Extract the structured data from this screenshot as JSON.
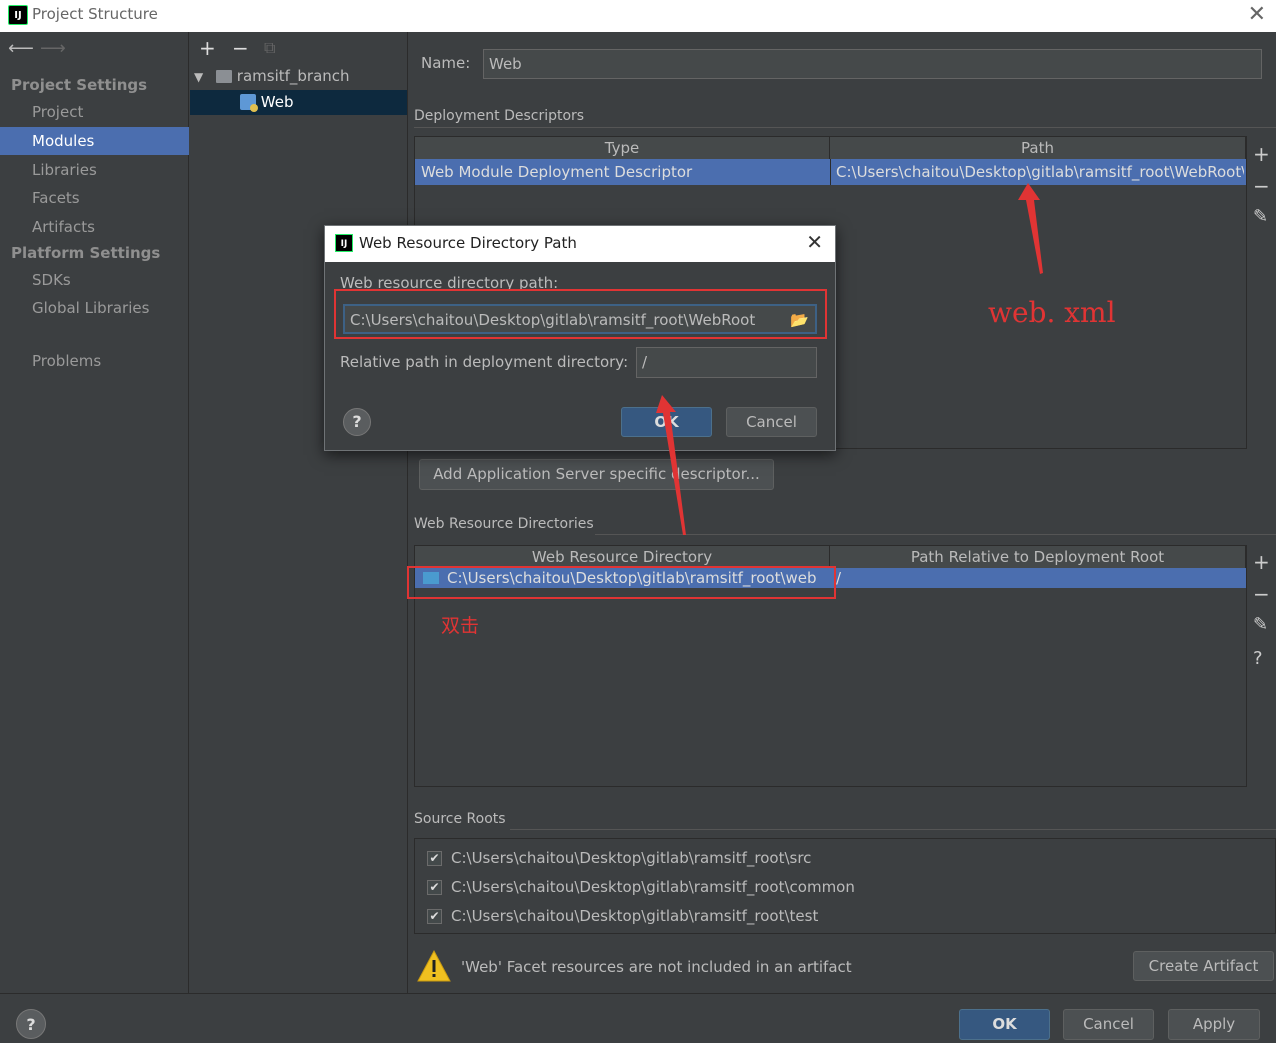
{
  "window": {
    "title": "Project Structure",
    "app_icon_text": "IJ"
  },
  "left": {
    "project_settings_label": "Project Settings",
    "project_items": [
      "Project",
      "Modules",
      "Libraries",
      "Facets",
      "Artifacts"
    ],
    "platform_settings_label": "Platform Settings",
    "platform_items": [
      "SDKs",
      "Global Libraries"
    ],
    "problems": "Problems"
  },
  "tree": {
    "root": "ramsitf_branch",
    "child": "Web"
  },
  "facet": {
    "name_label": "Name:",
    "name_value": "Web",
    "deployment_descriptors_title": "Deployment Descriptors",
    "dd_columns": [
      "Type",
      "Path"
    ],
    "dd_row": {
      "type": "Web Module Deployment Descriptor",
      "path": "C:\\Users\\chaitou\\Desktop\\gitlab\\ramsitf_root\\WebRoot\\"
    },
    "add_server_descriptor_button": "Add Application Server specific descriptor...",
    "web_resource_dirs_title": "Web Resource Directories",
    "wrd_columns": [
      "Web Resource Directory",
      "Path Relative to Deployment Root"
    ],
    "wrd_row": {
      "dir": "C:\\Users\\chaitou\\Desktop\\gitlab\\ramsitf_root\\web",
      "rel": "/"
    },
    "source_roots_title": "Source Roots",
    "source_roots": [
      "C:\\Users\\chaitou\\Desktop\\gitlab\\ramsitf_root\\src",
      "C:\\Users\\chaitou\\Desktop\\gitlab\\ramsitf_root\\common",
      "C:\\Users\\chaitou\\Desktop\\gitlab\\ramsitf_root\\test"
    ],
    "warning_text": "'Web' Facet resources are not included in an artifact",
    "create_artifact_button": "Create Artifact"
  },
  "dialog": {
    "title": "Web Resource Directory Path",
    "path_label": "Web resource directory path:",
    "path_value": "C:\\Users\\chaitou\\Desktop\\gitlab\\ramsitf_root\\WebRoot",
    "relative_label": "Relative path in deployment directory:",
    "relative_value": "/",
    "ok": "OK",
    "cancel": "Cancel",
    "help": "?"
  },
  "annotations": {
    "web_xml": "web. xml",
    "double_click": "双击"
  },
  "bottom": {
    "help": "?",
    "ok": "OK",
    "cancel": "Cancel",
    "apply": "Apply"
  },
  "colors": {
    "selection_blue": "#4b6eaf",
    "annotation_red": "#e03434",
    "background": "#3c3f41"
  }
}
